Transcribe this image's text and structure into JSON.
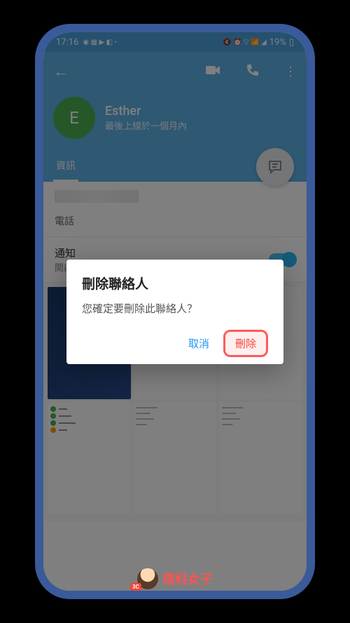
{
  "status_bar": {
    "time": "17:16",
    "battery_text": "19%"
  },
  "profile": {
    "avatar_letter": "E",
    "name": "Esther",
    "last_seen": "最後上線於一個月內"
  },
  "tabs": {
    "info": "資訊"
  },
  "info_section": {
    "phone_label": "電話"
  },
  "notifications": {
    "title": "通知",
    "status": "開啟"
  },
  "dialog": {
    "title": "刪除聯絡人",
    "message": "您確定要刪除此聯絡人？",
    "cancel": "取消",
    "delete": "刪除"
  },
  "watermark": {
    "badge": "3C",
    "text": "塔科女子"
  }
}
